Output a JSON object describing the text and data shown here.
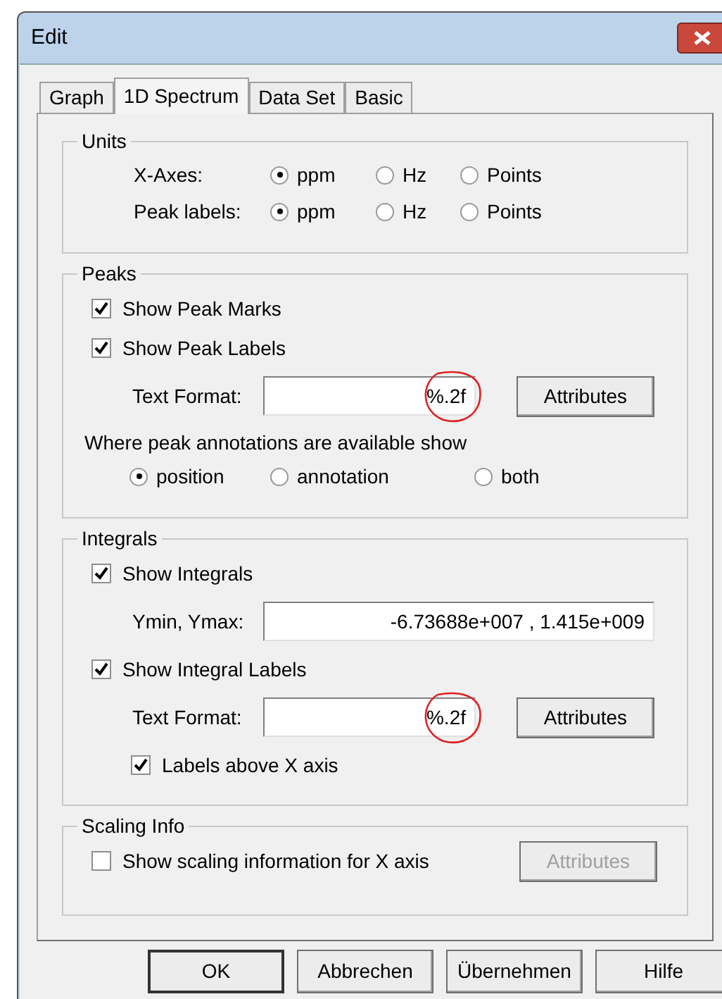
{
  "window": {
    "title": "Edit"
  },
  "tabs": [
    {
      "label": "Graph",
      "selected": false
    },
    {
      "label": "1D Spectrum",
      "selected": true
    },
    {
      "label": "Data Set",
      "selected": false
    },
    {
      "label": "Basic",
      "selected": false
    }
  ],
  "groups": [
    {
      "title": "Units",
      "items": [
        {
          "kind": "radio_row",
          "label": "X-Axes:",
          "options": [
            {
              "label": "ppm",
              "selected": true
            },
            {
              "label": "Hz",
              "selected": false
            },
            {
              "label": "Points",
              "selected": false
            }
          ]
        },
        {
          "kind": "radio_row",
          "label": "Peak labels:",
          "options": [
            {
              "label": "ppm",
              "selected": true
            },
            {
              "label": "Hz",
              "selected": false
            },
            {
              "label": "Points",
              "selected": false
            }
          ]
        }
      ]
    },
    {
      "title": "Peaks",
      "items": [
        {
          "kind": "checkbox",
          "label": "Show Peak Marks",
          "checked": true
        },
        {
          "kind": "checkbox",
          "label": "Show Peak Labels",
          "checked": true
        },
        {
          "kind": "field",
          "label": "Text Format:",
          "value": "%.2f",
          "annotated": true,
          "button": {
            "label": "Attributes",
            "disabled": false
          }
        },
        {
          "kind": "text",
          "text": "Where peak annotations are available show"
        },
        {
          "kind": "radio_options",
          "options": [
            {
              "label": "position",
              "selected": true
            },
            {
              "label": "annotation",
              "selected": false
            },
            {
              "label": "both",
              "selected": false
            }
          ]
        }
      ]
    },
    {
      "title": "Integrals",
      "items": [
        {
          "kind": "checkbox",
          "label": "Show Integrals",
          "checked": true
        },
        {
          "kind": "field",
          "label": "Ymin, Ymax:",
          "value": "-6.73688e+007 , 1.415e+009",
          "annotated": false
        },
        {
          "kind": "checkbox",
          "label": "Show Integral Labels",
          "checked": true
        },
        {
          "kind": "field",
          "label": "Text Format:",
          "value": "%.2f",
          "annotated": true,
          "button": {
            "label": "Attributes",
            "disabled": false
          }
        },
        {
          "kind": "sub_checkbox",
          "label": "Labels above X axis",
          "checked": true
        }
      ]
    },
    {
      "title": "Scaling Info",
      "items": [
        {
          "kind": "checkbox",
          "label": "Show scaling information for X axis",
          "checked": false,
          "button": {
            "label": "Attributes",
            "disabled": true
          }
        }
      ]
    }
  ],
  "buttons": [
    {
      "label": "OK",
      "default": true
    },
    {
      "label": "Abbrechen",
      "default": false
    },
    {
      "label": "Übernehmen",
      "default": false
    },
    {
      "label": "Hilfe",
      "default": false
    }
  ]
}
